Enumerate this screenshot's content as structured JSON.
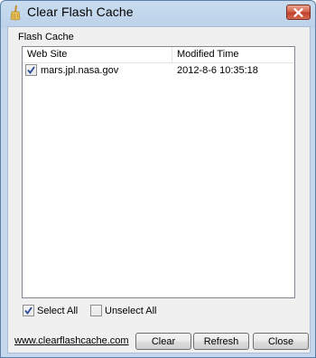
{
  "window": {
    "title": "Clear Flash Cache"
  },
  "group": {
    "label": "Flash Cache"
  },
  "list": {
    "columns": [
      "Web Site",
      "Modified Time"
    ],
    "rows": [
      {
        "site": "mars.jpl.nasa.gov",
        "time": "2012-8-6 10:35:18",
        "checked": true
      }
    ]
  },
  "options": {
    "select_all": "Select All",
    "unselect_all": "Unselect All"
  },
  "footer": {
    "link": "www.clearflashcache.com",
    "clear": "Clear",
    "refresh": "Refresh",
    "close": "Close"
  }
}
